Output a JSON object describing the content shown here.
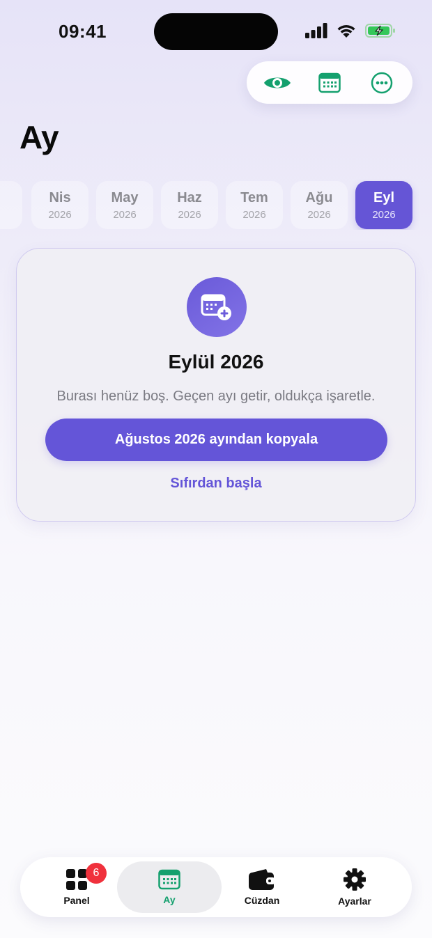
{
  "status_bar": {
    "time": "09:41"
  },
  "toolbar": {
    "icons": [
      "eye-icon",
      "calendar-icon",
      "more-icon"
    ],
    "accent_color": "#14a06e"
  },
  "page": {
    "title": "Ay"
  },
  "months": [
    {
      "month": "Nis",
      "year": "2026",
      "selected": false
    },
    {
      "month": "May",
      "year": "2026",
      "selected": false
    },
    {
      "month": "Haz",
      "year": "2026",
      "selected": false
    },
    {
      "month": "Tem",
      "year": "2026",
      "selected": false
    },
    {
      "month": "Ağu",
      "year": "2026",
      "selected": false
    },
    {
      "month": "Eyl",
      "year": "2026",
      "selected": true
    }
  ],
  "empty_state": {
    "icon": "calendar-add-icon",
    "title": "Eylül 2026",
    "message": "Burası henüz boş. Geçen ayı getir, oldukça işaretle.",
    "copy_button": "Ağustos 2026 ayından kopyala",
    "start_link": "Sıfırdan başla"
  },
  "tab_bar": {
    "items": [
      {
        "label": "Panel",
        "icon": "grid-icon",
        "badge": "6",
        "active": false
      },
      {
        "label": "Ay",
        "icon": "calendar-icon",
        "active": true
      },
      {
        "label": "Cüzdan",
        "icon": "wallet-icon",
        "active": false
      },
      {
        "label": "Ayarlar",
        "icon": "gear-icon",
        "active": false
      }
    ]
  },
  "colors": {
    "primary": "#6455d8",
    "active_tab": "#14a06e",
    "badge": "#f0313c"
  }
}
